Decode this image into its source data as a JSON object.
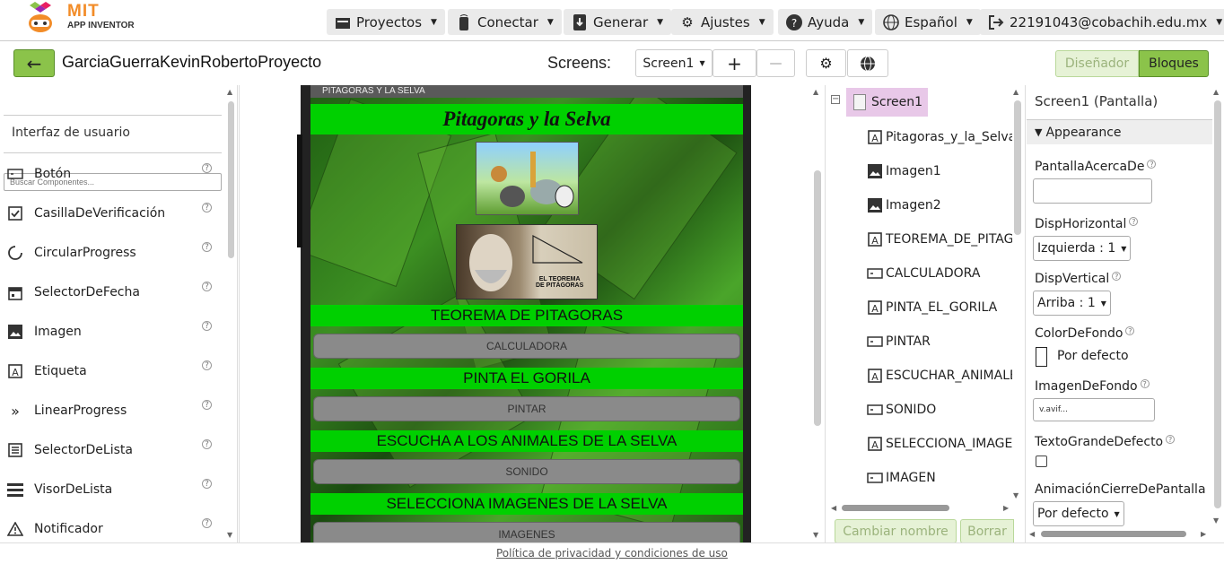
{
  "app": {
    "logo_line1": "MIT",
    "logo_line2": "APP INVENTOR"
  },
  "nav": [
    {
      "label": "Proyectos",
      "icon": "folder-icon"
    },
    {
      "label": "Conectar",
      "icon": "phone-icon"
    },
    {
      "label": "Generar",
      "icon": "build-icon"
    },
    {
      "label": "Ajustes",
      "icon": "gear-icon"
    },
    {
      "label": "Ayuda",
      "icon": "help-icon"
    },
    {
      "label": "Español",
      "icon": "globe-icon"
    },
    {
      "label": "22191043@cobachih.edu.mx",
      "icon": "logout-icon"
    }
  ],
  "project": {
    "name": "GarciaGuerraKevinRobertoProyecto"
  },
  "screens": {
    "label": "Screens:",
    "current": "Screen1",
    "add": "+",
    "remove": "—"
  },
  "mode": {
    "designer": "Diseñador",
    "blocks": "Bloques"
  },
  "palette": {
    "search_placeholder": "Buscar Componentes...",
    "category": "Interfaz de usuario",
    "items": [
      {
        "label": "Botón",
        "icon": "button-icon"
      },
      {
        "label": "CasillaDeVerificación",
        "icon": "checkbox-icon"
      },
      {
        "label": "CircularProgress",
        "icon": "circular-progress-icon"
      },
      {
        "label": "SelectorDeFecha",
        "icon": "calendar-icon"
      },
      {
        "label": "Imagen",
        "icon": "image-icon"
      },
      {
        "label": "Etiqueta",
        "icon": "label-icon"
      },
      {
        "label": "LinearProgress",
        "icon": "linear-progress-icon"
      },
      {
        "label": "SelectorDeLista",
        "icon": "list-picker-icon"
      },
      {
        "label": "VisorDeLista",
        "icon": "list-view-icon"
      },
      {
        "label": "Notificador",
        "icon": "warning-icon"
      }
    ]
  },
  "phone": {
    "title_bar": "PITAGORAS Y LA SELVA",
    "heading": "Pitagoras y la Selva",
    "image2_caption": "EL TEOREMA\nDE PITÁGORAS",
    "sections": [
      {
        "title": "TEOREMA DE PITAGORAS",
        "button": "CALCULADORA"
      },
      {
        "title": "PINTA EL GORILA",
        "button": "PINTAR"
      },
      {
        "title": "ESCUCHA A LOS ANIMALES DE LA SELVA",
        "button": "SONIDO"
      },
      {
        "title": "SELECCIONA IMAGENES DE LA SELVA",
        "button": "IMAGENES"
      }
    ]
  },
  "tree": {
    "root": "Screen1",
    "items": [
      {
        "label": "Pitagoras_y_la_Selva",
        "icon": "label-icon"
      },
      {
        "label": "Imagen1",
        "icon": "image-icon"
      },
      {
        "label": "Imagen2",
        "icon": "image-icon"
      },
      {
        "label": "TEOREMA_DE_PITAGORAS",
        "icon": "label-icon"
      },
      {
        "label": "CALCULADORA",
        "icon": "button-icon"
      },
      {
        "label": "PINTA_EL_GORILA",
        "icon": "label-icon"
      },
      {
        "label": "PINTAR",
        "icon": "button-icon"
      },
      {
        "label": "ESCUCHAR_ANIMALES",
        "icon": "label-icon"
      },
      {
        "label": "SONIDO",
        "icon": "button-icon"
      },
      {
        "label": "SELECCIONA_IMAGENES",
        "icon": "label-icon"
      },
      {
        "label": "IMAGEN",
        "icon": "button-icon"
      }
    ],
    "rename": "Cambiar nombre",
    "delete": "Borrar"
  },
  "props": {
    "title": "Screen1 (Pantalla)",
    "section": "Appearance",
    "about_label": "PantallaAcercaDe",
    "about_value": "",
    "halign_label": "DispHorizontal",
    "halign_value": "Izquierda : 1",
    "valign_label": "DispVertical",
    "valign_value": "Arriba : 1",
    "bgcolor_label": "ColorDeFondo",
    "bgcolor_value": "Por defecto",
    "bgimage_label": "ImagenDeFondo",
    "bgimage_value": "v.avif...",
    "bigtext_label": "TextoGrandeDefecto",
    "closeanim_label": "AnimaciónCierreDePantalla",
    "closeanim_value": "Por defecto"
  },
  "footer": {
    "link": "Política de privacidad y condiciones de uso"
  },
  "colors": {
    "accent_green": "#8bc34a",
    "banner_green": "#00d000",
    "tree_selected": "#e8c8e8"
  }
}
